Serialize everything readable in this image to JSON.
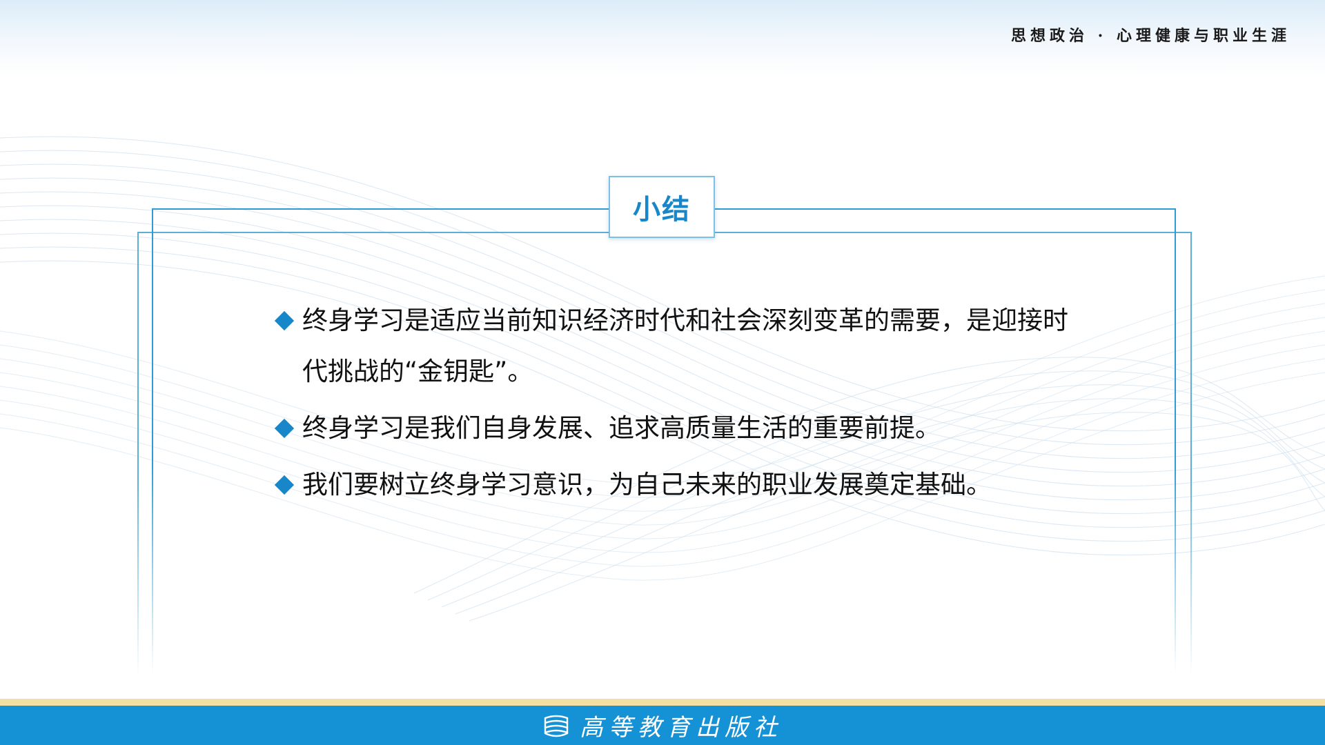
{
  "header": {
    "course_title": "思想政治 · 心理健康与职业生涯"
  },
  "section": {
    "title": "小结"
  },
  "bullets": [
    {
      "text": "终身学习是适应当前知识经济时代和社会深刻变革的需要，是迎接时代挑战的“金钥匙”。"
    },
    {
      "text": "终身学习是我们自身发展、追求高质量生活的重要前提。"
    },
    {
      "text": "我们要树立终身学习意识，为自己未来的职业发展奠定基础。"
    }
  ],
  "footer": {
    "publisher": "高等教育出版社",
    "logo_icon": "book-stack-icon"
  },
  "colors": {
    "accent": "#1787c9",
    "footer_bar": "#1592d6",
    "gold_line": "#f3dfa2"
  }
}
